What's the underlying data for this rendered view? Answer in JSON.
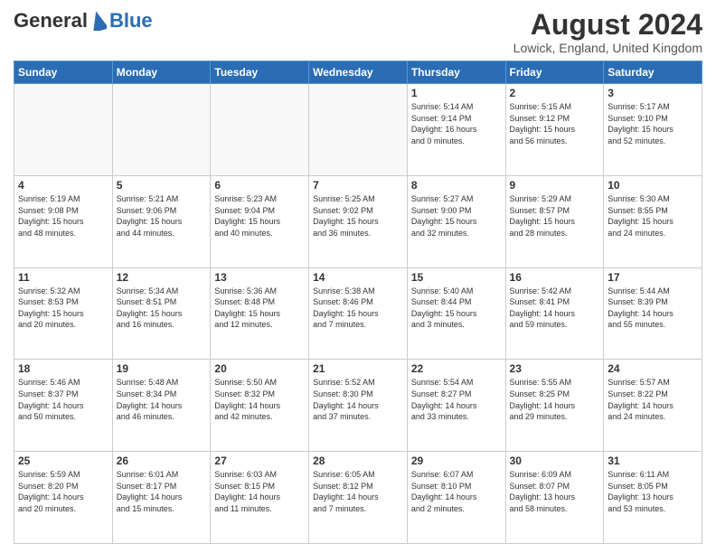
{
  "header": {
    "logo_general": "General",
    "logo_blue": "Blue",
    "month_year": "August 2024",
    "location": "Lowick, England, United Kingdom"
  },
  "days_of_week": [
    "Sunday",
    "Monday",
    "Tuesday",
    "Wednesday",
    "Thursday",
    "Friday",
    "Saturday"
  ],
  "weeks": [
    [
      {
        "day": "",
        "content": ""
      },
      {
        "day": "",
        "content": ""
      },
      {
        "day": "",
        "content": ""
      },
      {
        "day": "",
        "content": ""
      },
      {
        "day": "1",
        "content": "Sunrise: 5:14 AM\nSunset: 9:14 PM\nDaylight: 16 hours\nand 0 minutes."
      },
      {
        "day": "2",
        "content": "Sunrise: 5:15 AM\nSunset: 9:12 PM\nDaylight: 15 hours\nand 56 minutes."
      },
      {
        "day": "3",
        "content": "Sunrise: 5:17 AM\nSunset: 9:10 PM\nDaylight: 15 hours\nand 52 minutes."
      }
    ],
    [
      {
        "day": "4",
        "content": "Sunrise: 5:19 AM\nSunset: 9:08 PM\nDaylight: 15 hours\nand 48 minutes."
      },
      {
        "day": "5",
        "content": "Sunrise: 5:21 AM\nSunset: 9:06 PM\nDaylight: 15 hours\nand 44 minutes."
      },
      {
        "day": "6",
        "content": "Sunrise: 5:23 AM\nSunset: 9:04 PM\nDaylight: 15 hours\nand 40 minutes."
      },
      {
        "day": "7",
        "content": "Sunrise: 5:25 AM\nSunset: 9:02 PM\nDaylight: 15 hours\nand 36 minutes."
      },
      {
        "day": "8",
        "content": "Sunrise: 5:27 AM\nSunset: 9:00 PM\nDaylight: 15 hours\nand 32 minutes."
      },
      {
        "day": "9",
        "content": "Sunrise: 5:29 AM\nSunset: 8:57 PM\nDaylight: 15 hours\nand 28 minutes."
      },
      {
        "day": "10",
        "content": "Sunrise: 5:30 AM\nSunset: 8:55 PM\nDaylight: 15 hours\nand 24 minutes."
      }
    ],
    [
      {
        "day": "11",
        "content": "Sunrise: 5:32 AM\nSunset: 8:53 PM\nDaylight: 15 hours\nand 20 minutes."
      },
      {
        "day": "12",
        "content": "Sunrise: 5:34 AM\nSunset: 8:51 PM\nDaylight: 15 hours\nand 16 minutes."
      },
      {
        "day": "13",
        "content": "Sunrise: 5:36 AM\nSunset: 8:48 PM\nDaylight: 15 hours\nand 12 minutes."
      },
      {
        "day": "14",
        "content": "Sunrise: 5:38 AM\nSunset: 8:46 PM\nDaylight: 15 hours\nand 7 minutes."
      },
      {
        "day": "15",
        "content": "Sunrise: 5:40 AM\nSunset: 8:44 PM\nDaylight: 15 hours\nand 3 minutes."
      },
      {
        "day": "16",
        "content": "Sunrise: 5:42 AM\nSunset: 8:41 PM\nDaylight: 14 hours\nand 59 minutes."
      },
      {
        "day": "17",
        "content": "Sunrise: 5:44 AM\nSunset: 8:39 PM\nDaylight: 14 hours\nand 55 minutes."
      }
    ],
    [
      {
        "day": "18",
        "content": "Sunrise: 5:46 AM\nSunset: 8:37 PM\nDaylight: 14 hours\nand 50 minutes."
      },
      {
        "day": "19",
        "content": "Sunrise: 5:48 AM\nSunset: 8:34 PM\nDaylight: 14 hours\nand 46 minutes."
      },
      {
        "day": "20",
        "content": "Sunrise: 5:50 AM\nSunset: 8:32 PM\nDaylight: 14 hours\nand 42 minutes."
      },
      {
        "day": "21",
        "content": "Sunrise: 5:52 AM\nSunset: 8:30 PM\nDaylight: 14 hours\nand 37 minutes."
      },
      {
        "day": "22",
        "content": "Sunrise: 5:54 AM\nSunset: 8:27 PM\nDaylight: 14 hours\nand 33 minutes."
      },
      {
        "day": "23",
        "content": "Sunrise: 5:55 AM\nSunset: 8:25 PM\nDaylight: 14 hours\nand 29 minutes."
      },
      {
        "day": "24",
        "content": "Sunrise: 5:57 AM\nSunset: 8:22 PM\nDaylight: 14 hours\nand 24 minutes."
      }
    ],
    [
      {
        "day": "25",
        "content": "Sunrise: 5:59 AM\nSunset: 8:20 PM\nDaylight: 14 hours\nand 20 minutes."
      },
      {
        "day": "26",
        "content": "Sunrise: 6:01 AM\nSunset: 8:17 PM\nDaylight: 14 hours\nand 15 minutes."
      },
      {
        "day": "27",
        "content": "Sunrise: 6:03 AM\nSunset: 8:15 PM\nDaylight: 14 hours\nand 11 minutes."
      },
      {
        "day": "28",
        "content": "Sunrise: 6:05 AM\nSunset: 8:12 PM\nDaylight: 14 hours\nand 7 minutes."
      },
      {
        "day": "29",
        "content": "Sunrise: 6:07 AM\nSunset: 8:10 PM\nDaylight: 14 hours\nand 2 minutes."
      },
      {
        "day": "30",
        "content": "Sunrise: 6:09 AM\nSunset: 8:07 PM\nDaylight: 13 hours\nand 58 minutes."
      },
      {
        "day": "31",
        "content": "Sunrise: 6:11 AM\nSunset: 8:05 PM\nDaylight: 13 hours\nand 53 minutes."
      }
    ]
  ]
}
